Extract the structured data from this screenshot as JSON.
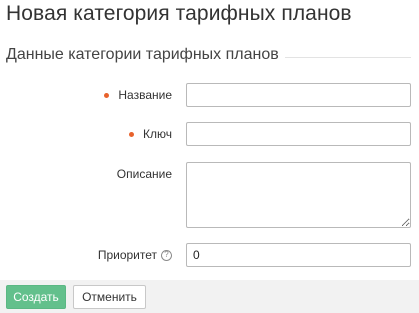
{
  "page": {
    "title": "Новая категория тарифных планов"
  },
  "section": {
    "legend": "Данные категории тарифных планов"
  },
  "form": {
    "name": {
      "label": "Название",
      "required": true,
      "value": ""
    },
    "key": {
      "label": "Ключ",
      "required": true,
      "value": ""
    },
    "description": {
      "label": "Описание",
      "required": false,
      "value": ""
    },
    "priority": {
      "label": "Приоритет",
      "help_icon": "question-circle-icon",
      "value": "0"
    }
  },
  "actions": {
    "create_label": "Создать",
    "cancel_label": "Отменить"
  },
  "colors": {
    "required_marker": "#e8622c",
    "primary_button": "#63c08c",
    "footer_background": "#f2f2f2"
  }
}
